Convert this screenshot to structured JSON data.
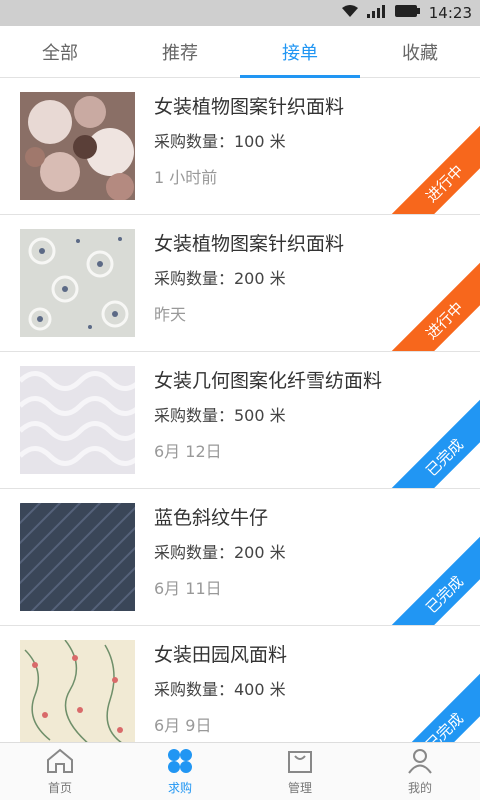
{
  "status_bar": {
    "time": "14:23"
  },
  "tabs": [
    {
      "label": "全部"
    },
    {
      "label": "推荐"
    },
    {
      "label": "接单"
    },
    {
      "label": "收藏"
    }
  ],
  "active_tab": "接单",
  "orders": [
    {
      "title": "女装植物图案针织面料",
      "qty": "采购数量：100 米",
      "time": "1 小时前",
      "status": "进行中",
      "color": "#f7671c"
    },
    {
      "title": "女装植物图案针织面料",
      "qty": "采购数量：200 米",
      "time": "昨天",
      "status": "进行中",
      "color": "#f7671c"
    },
    {
      "title": "女装几何图案化纤雪纺面料",
      "qty": "采购数量：500 米",
      "time": "6月 12日",
      "status": "已完成",
      "color": "#2196f3"
    },
    {
      "title": "蓝色斜纹牛仔",
      "qty": "采购数量：200 米",
      "time": "6月 11日",
      "status": "已完成",
      "color": "#2196f3"
    },
    {
      "title": "女装田园风面料",
      "qty": "采购数量：400 米",
      "time": "6月 9日",
      "status": "已完成",
      "color": "#2196f3"
    }
  ],
  "bottom_nav": [
    {
      "label": "首页",
      "icon": "home-icon"
    },
    {
      "label": "求购",
      "icon": "clover-icon"
    },
    {
      "label": "管理",
      "icon": "bag-icon"
    },
    {
      "label": "我的",
      "icon": "user-icon"
    }
  ],
  "colors": {
    "accent": "#2196f3",
    "in_progress": "#f7671c"
  }
}
